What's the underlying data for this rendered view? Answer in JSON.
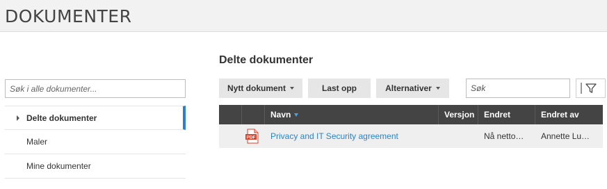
{
  "header": {
    "title": "DOKUMENTER"
  },
  "sidebar": {
    "search_placeholder": "Søk i alle dokumenter...",
    "items": [
      {
        "label": "Delte dokumenter",
        "active": true
      },
      {
        "label": "Maler",
        "active": false
      },
      {
        "label": "Mine dokumenter",
        "active": false
      }
    ]
  },
  "main": {
    "title": "Delte dokumenter",
    "toolbar": {
      "new_label": "Nytt dokument",
      "upload_label": "Last opp",
      "options_label": "Alternativer",
      "search_placeholder": "Søk"
    },
    "table": {
      "columns": [
        "",
        "",
        "Navn",
        "Versjon",
        "Endret",
        "Endret av"
      ],
      "rows": [
        {
          "icon": "pdf-file-icon",
          "icon_text": "PDF",
          "name": "Privacy and IT Security agreement",
          "version": "",
          "modified": "Nå netto…",
          "modified_by": "Annette Lu…"
        }
      ]
    }
  },
  "colors": {
    "accent": "#2b83c6",
    "header_bg": "#444444",
    "pdf_red": "#d9412b"
  }
}
